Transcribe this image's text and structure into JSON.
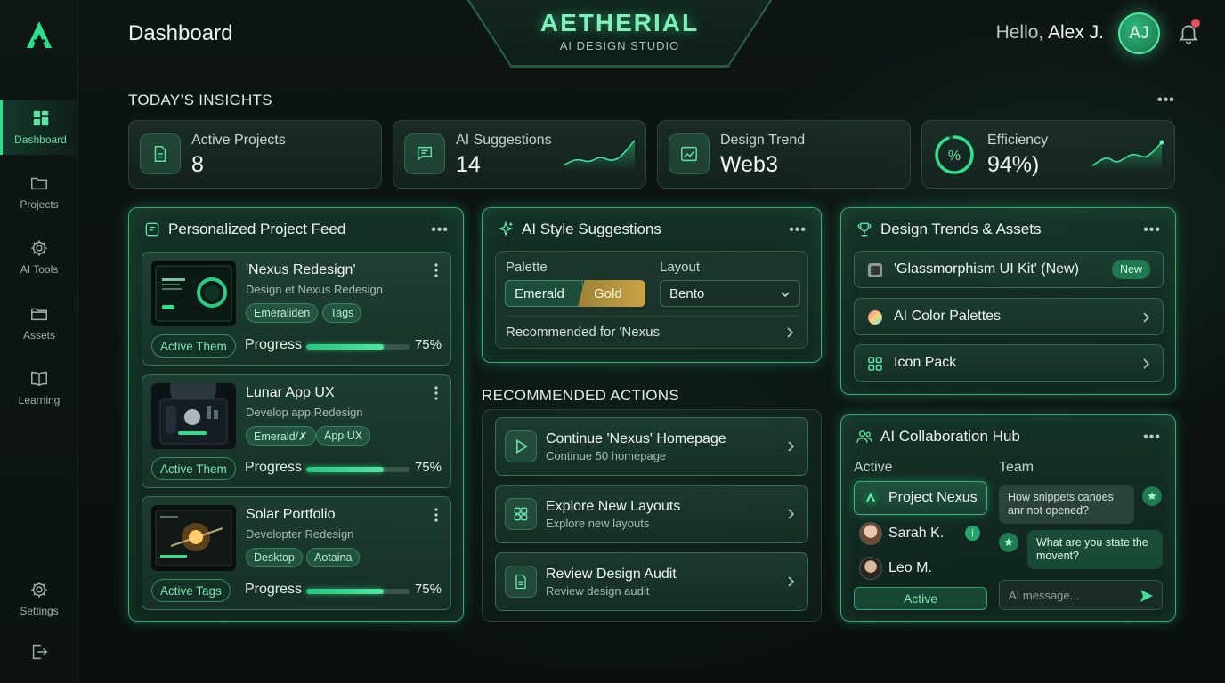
{
  "header": {
    "title": "Dashboard",
    "greeting": "Hello,",
    "user_name": "Alex J.",
    "avatar_initials": "AJ"
  },
  "brand": {
    "name": "AETHERIAL",
    "tagline": "AI DESIGN STUDIO"
  },
  "sidebar": {
    "items": [
      {
        "label": "Dashboard",
        "icon": "grid-icon",
        "active": true
      },
      {
        "label": "Projects",
        "icon": "folder-icon"
      },
      {
        "label": "AI Tools",
        "icon": "gear-icon"
      },
      {
        "label": "Assets",
        "icon": "folder-icon"
      },
      {
        "label": "Learning",
        "icon": "book-icon"
      },
      {
        "label": "Settings",
        "icon": "gear-icon"
      }
    ]
  },
  "insights": {
    "title": "TODAY’S INSIGHTS",
    "stats": [
      {
        "label": "Active Projects",
        "value": "8"
      },
      {
        "label": "AI Suggestions",
        "value": "14"
      },
      {
        "label": "Design Trend",
        "value": "Web3"
      },
      {
        "label": "Efficiency",
        "value": "94%)"
      }
    ]
  },
  "feed": {
    "title": "Personalized Project Feed",
    "projects": [
      {
        "title": "'Nexus Redesign'",
        "subtitle": "Design et Nexus Redesign",
        "tags": [
          "Emeraliden",
          "Tags"
        ],
        "status": "Active Them",
        "progress_label": "Progress",
        "progress": "75%",
        "progress_fraction": 0.75
      },
      {
        "title": "Lunar App UX",
        "subtitle": "Develop app Redesign",
        "tags": [
          "Emerald/✗",
          "App UX"
        ],
        "status": "Active Them",
        "progress_label": "Progress",
        "progress": "75%",
        "progress_fraction": 0.75
      },
      {
        "title": "Solar Portfolio",
        "subtitle": "Developter Redesign",
        "tags": [
          "Desktop",
          "Aotaina"
        ],
        "status": "Active Tags",
        "progress_label": "Progress",
        "progress": "75%",
        "progress_fraction": 0.75
      }
    ]
  },
  "style": {
    "title": "AI Style Suggestions",
    "palette_label": "Palette",
    "palette_options": [
      "Emerald",
      "Gold"
    ],
    "layout_label": "Layout",
    "layout_value": "Bento",
    "recommended": "Recommended for 'Nexus"
  },
  "actions": {
    "title": "RECOMMENDED ACTIONS",
    "items": [
      {
        "title": "Continue 'Nexus' Homepage",
        "subtitle": "Continue 50 homepage"
      },
      {
        "title": "Explore New Layouts",
        "subtitle": "Explore new layouts"
      },
      {
        "title": "Review Design Audit",
        "subtitle": "Review design audit"
      }
    ]
  },
  "trends": {
    "title": "Design Trends & Assets",
    "items": [
      {
        "label": "'Glassmorphism UI Kit' (New)",
        "badge": "New"
      },
      {
        "label": "AI Color Palettes"
      },
      {
        "label": "Icon Pack"
      }
    ]
  },
  "collab": {
    "title": "AI Collaboration Hub",
    "active_label": "Active",
    "team_label": "Team",
    "project": "Project Nexus",
    "members": [
      "Sarah K.",
      "Leo M."
    ],
    "active_button": "Active",
    "messages": [
      "How snippets canoes anr not opened?",
      "What are you state the movent?"
    ],
    "input_placeholder": "AI message..."
  },
  "colors": {
    "accent": "#2ee08c",
    "gold": "#c9a445",
    "bg": "#0b1210"
  }
}
